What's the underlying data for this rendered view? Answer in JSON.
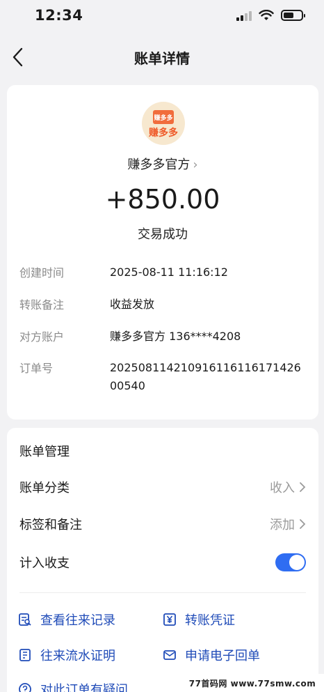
{
  "status_bar": {
    "time": "12:34"
  },
  "nav": {
    "title": "账单详情"
  },
  "summary": {
    "logo_box": "赚多多",
    "logo_text": "赚多多",
    "merchant": "赚多多官方",
    "amount": "+850.00",
    "status": "交易成功"
  },
  "details": [
    {
      "label": "创建时间",
      "value": "2025-08-11 11:16:12"
    },
    {
      "label": "转账备注",
      "value": "收益发放"
    },
    {
      "label": "对方账户",
      "value": "赚多多官方 136****4208"
    },
    {
      "label": "订单号",
      "value": "20250811421091611611617142600540"
    }
  ],
  "management": {
    "title": "账单管理",
    "category_label": "账单分类",
    "category_value": "收入",
    "tags_label": "标签和备注",
    "tags_value": "添加",
    "include_label": "计入收支",
    "include_on": true
  },
  "links": {
    "history": "查看往来记录",
    "voucher": "转账凭证",
    "statement": "往来流水证明",
    "receipt": "申请电子回单",
    "question": "对此订单有疑问"
  },
  "watermark": "77首码网 www.77smw.com",
  "colors": {
    "accent": "#2f6df2",
    "link": "#1f4bb8",
    "background": "#f2f2f4"
  }
}
